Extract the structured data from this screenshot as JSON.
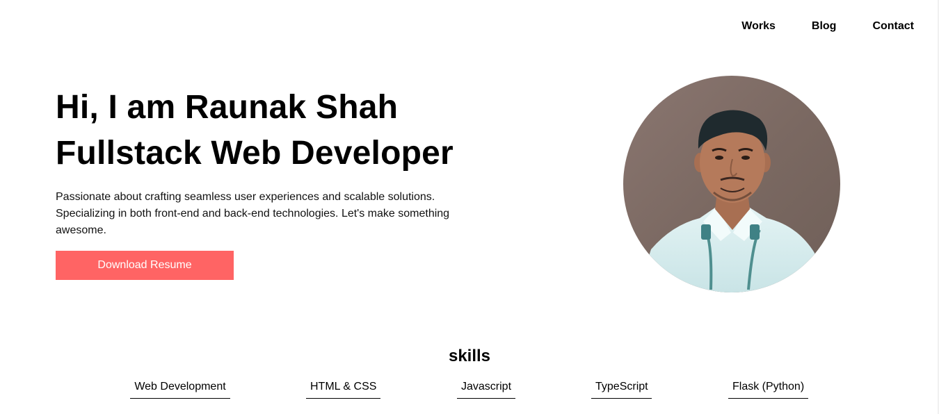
{
  "nav": {
    "items": [
      "Works",
      "Blog",
      "Contact"
    ]
  },
  "hero": {
    "line1": "Hi, I am Raunak Shah",
    "line2": "Fullstack Web Developer",
    "description": "Passionate about crafting seamless user experiences and scalable solutions. Specializing in both front-end and back-end technologies. Let's make something awesome.",
    "button_label": "Download Resume"
  },
  "skills": {
    "title": "skills",
    "items": [
      "Web Development",
      "HTML & CSS",
      "Javascript",
      "TypeScript",
      "Flask (Python)"
    ]
  },
  "colors": {
    "accent": "#ff6464",
    "text": "#000000",
    "background": "#ffffff"
  }
}
